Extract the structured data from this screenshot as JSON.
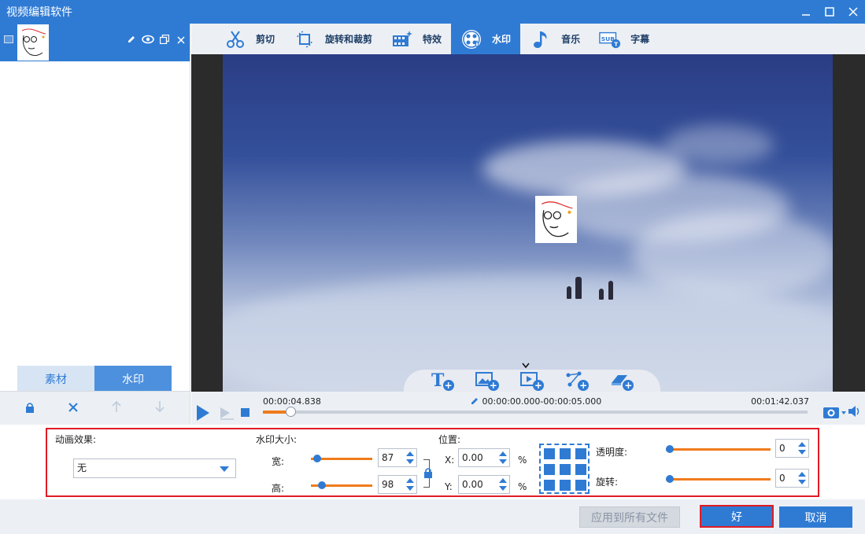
{
  "window": {
    "title": "视频编辑软件"
  },
  "left": {
    "tabs": [
      {
        "label": "素材",
        "active": false
      },
      {
        "label": "水印",
        "active": true
      }
    ]
  },
  "tabs": [
    {
      "label": "剪切",
      "icon": "scissors-icon",
      "active": false
    },
    {
      "label": "旋转和裁剪",
      "icon": "crop-rotate-icon",
      "active": false
    },
    {
      "label": "特效",
      "icon": "effects-icon",
      "active": false
    },
    {
      "label": "水印",
      "icon": "watermark-icon",
      "active": true
    },
    {
      "label": "音乐",
      "icon": "music-icon",
      "active": false
    },
    {
      "label": "字幕",
      "icon": "subtitle-icon",
      "active": false
    }
  ],
  "timeline": {
    "current_time": "00:00:04.838",
    "range": "00:00:00.000-00:00:05.000",
    "total_time": "00:01:42.037",
    "progress": 0.05
  },
  "settings": {
    "animation": {
      "label": "动画效果:",
      "value": "无"
    },
    "size": {
      "label": "水印大小:",
      "width_label": "宽:",
      "width_value": "87",
      "width_fraction": 0.1,
      "height_label": "高:",
      "height_value": "98",
      "height_fraction": 0.18
    },
    "position": {
      "label": "位置:",
      "x_label": "X:",
      "x_value": "0.00",
      "y_label": "Y:",
      "y_value": "0.00",
      "unit": "%"
    },
    "opacity": {
      "label": "透明度:",
      "value": "0",
      "fraction": 0
    },
    "rotation": {
      "label": "旋转:",
      "value": "0",
      "fraction": 0
    }
  },
  "buttons": {
    "apply_all": "应用到所有文件",
    "ok": "好",
    "cancel": "取消"
  },
  "colors": {
    "accent": "#2f7bd4",
    "slider": "#f07b1c",
    "highlight": "#e01c24"
  }
}
